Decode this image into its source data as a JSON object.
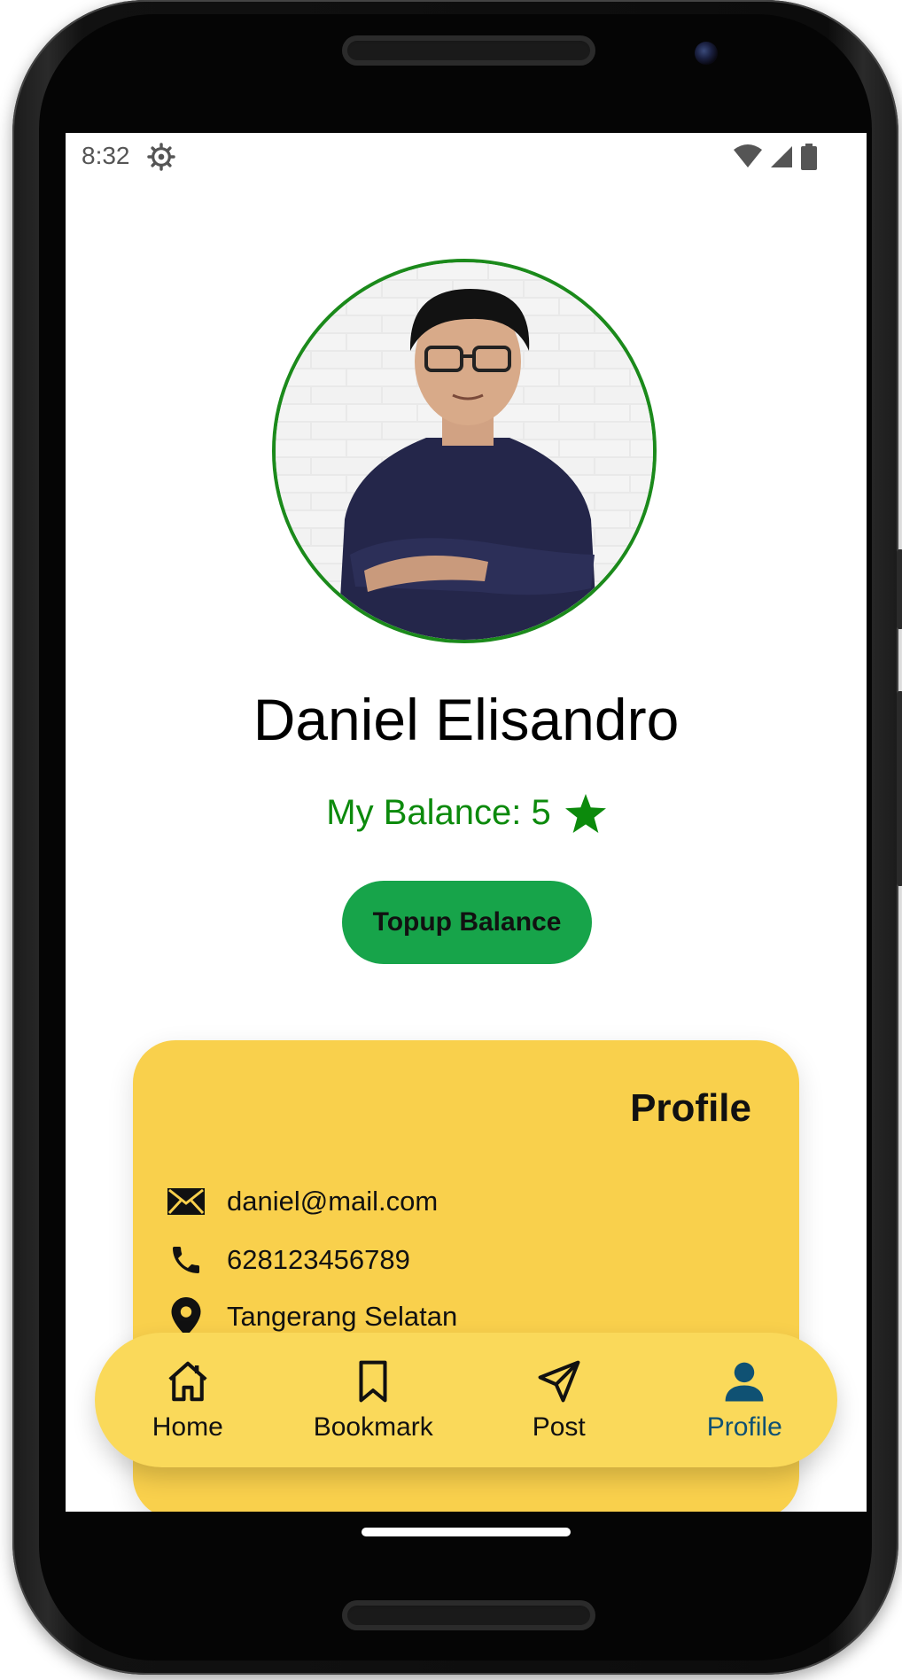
{
  "status_bar": {
    "time": "8:32",
    "icons": [
      "settings-gear-icon",
      "wifi-icon",
      "signal-icon",
      "battery-icon"
    ]
  },
  "profile": {
    "name": "Daniel Elisandro",
    "balance_label": "My Balance: 5",
    "balance_icon": "star-icon",
    "topup_label": "Topup Balance"
  },
  "card": {
    "title": "Profile",
    "email": "daniel@mail.com",
    "phone": "628123456789",
    "location": "Tangerang Selatan"
  },
  "nav": {
    "items": [
      {
        "label": "Home",
        "icon": "home-icon"
      },
      {
        "label": "Bookmark",
        "icon": "bookmark-icon"
      },
      {
        "label": "Post",
        "icon": "send-icon"
      },
      {
        "label": "Profile",
        "icon": "person-icon"
      }
    ],
    "active": "Profile"
  },
  "colors": {
    "balance_green": "#0c8a0c",
    "topup_green": "#17a44a",
    "card_yellow": "#f9d04c",
    "nav_yellow": "#fad95a",
    "active_nav": "#0f5173"
  }
}
